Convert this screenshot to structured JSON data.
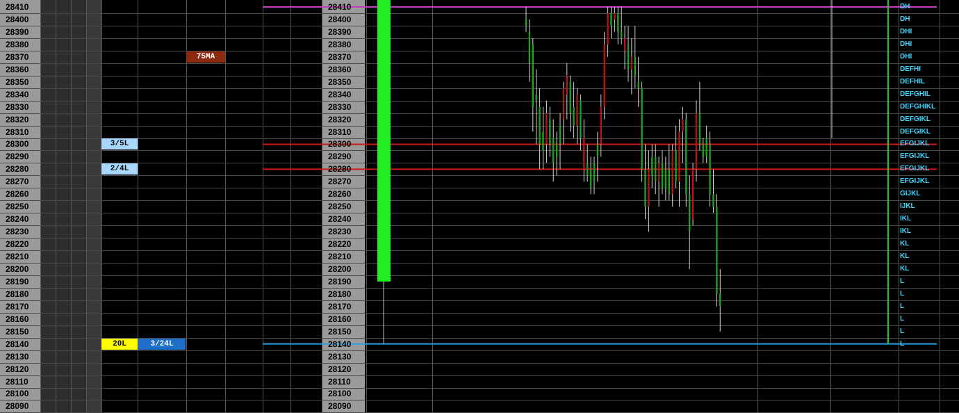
{
  "chart_data": {
    "type": "candlestick",
    "price_axis": {
      "ticks": [
        28410,
        28400,
        28390,
        28380,
        28370,
        28360,
        28350,
        28340,
        28330,
        28320,
        28310,
        28300,
        28290,
        28280,
        28270,
        28260,
        28250,
        28240,
        28230,
        28220,
        28210,
        28200,
        28190,
        28180,
        28170,
        28160,
        28150,
        28140,
        28130,
        28120,
        28110,
        28100,
        28090
      ],
      "ylim": [
        28090,
        28410
      ]
    },
    "level_tags": [
      {
        "label": "75MA",
        "price": 28370,
        "color": "#8a2a10",
        "text_color": "#ffffff"
      },
      {
        "label": "3/5L",
        "price": 28300,
        "color": "#a8d8ff",
        "text_color": "#000000"
      },
      {
        "label": "2/4L",
        "price": 28280,
        "color": "#a8d8ff",
        "text_color": "#000000"
      },
      {
        "label": "20L",
        "price": 28140,
        "color": "#ffff00",
        "text_color": "#000000"
      },
      {
        "label": "3/24L",
        "price": 28140,
        "color": "#1f6fc8",
        "text_color": "#ffffff"
      }
    ],
    "horizontal_lines": [
      {
        "price": 28410,
        "color": "#c040c0"
      },
      {
        "price": 28300,
        "color": "#cc1a1a"
      },
      {
        "price": 28280,
        "color": "#cc1a1a"
      },
      {
        "price": 28140,
        "color": "#2aa0e0"
      }
    ],
    "volume_bar": {
      "top": 28410,
      "bottom": 28190,
      "wick_low": 28140,
      "color": "#22ee22"
    },
    "candles": [
      {
        "o": 28395,
        "h": 28410,
        "l": 28390,
        "c": 28400,
        "color": "green"
      },
      {
        "o": 28390,
        "h": 28400,
        "l": 28350,
        "c": 28365,
        "color": "green"
      },
      {
        "o": 28380,
        "h": 28385,
        "l": 28310,
        "c": 28330,
        "color": "green"
      },
      {
        "o": 28340,
        "h": 28360,
        "l": 28300,
        "c": 28335,
        "color": "green"
      },
      {
        "o": 28330,
        "h": 28345,
        "l": 28280,
        "c": 28300,
        "color": "green"
      },
      {
        "o": 28310,
        "h": 28330,
        "l": 28280,
        "c": 28295,
        "color": "green"
      },
      {
        "o": 28300,
        "h": 28335,
        "l": 28285,
        "c": 28325,
        "color": "red"
      },
      {
        "o": 28320,
        "h": 28330,
        "l": 28290,
        "c": 28300,
        "color": "green"
      },
      {
        "o": 28305,
        "h": 28320,
        "l": 28270,
        "c": 28285,
        "color": "green"
      },
      {
        "o": 28290,
        "h": 28310,
        "l": 28275,
        "c": 28300,
        "color": "green"
      },
      {
        "o": 28300,
        "h": 28325,
        "l": 28280,
        "c": 28315,
        "color": "green"
      },
      {
        "o": 28320,
        "h": 28350,
        "l": 28300,
        "c": 28345,
        "color": "red"
      },
      {
        "o": 28340,
        "h": 28365,
        "l": 28320,
        "c": 28355,
        "color": "red"
      },
      {
        "o": 28350,
        "h": 28355,
        "l": 28310,
        "c": 28325,
        "color": "green"
      },
      {
        "o": 28330,
        "h": 28350,
        "l": 28305,
        "c": 28315,
        "color": "green"
      },
      {
        "o": 28315,
        "h": 28345,
        "l": 28300,
        "c": 28340,
        "color": "red"
      },
      {
        "o": 28335,
        "h": 28340,
        "l": 28295,
        "c": 28305,
        "color": "green"
      },
      {
        "o": 28305,
        "h": 28320,
        "l": 28270,
        "c": 28280,
        "color": "red"
      },
      {
        "o": 28285,
        "h": 28300,
        "l": 28270,
        "c": 28275,
        "color": "green"
      },
      {
        "o": 28280,
        "h": 28290,
        "l": 28260,
        "c": 28265,
        "color": "green"
      },
      {
        "o": 28270,
        "h": 28290,
        "l": 28260,
        "c": 28285,
        "color": "green"
      },
      {
        "o": 28290,
        "h": 28310,
        "l": 28270,
        "c": 28300,
        "color": "green"
      },
      {
        "o": 28300,
        "h": 28340,
        "l": 28290,
        "c": 28330,
        "color": "red"
      },
      {
        "o": 28330,
        "h": 28390,
        "l": 28320,
        "c": 28380,
        "color": "red"
      },
      {
        "o": 28380,
        "h": 28410,
        "l": 28370,
        "c": 28405,
        "color": "red"
      },
      {
        "o": 28405,
        "h": 28410,
        "l": 28385,
        "c": 28395,
        "color": "green"
      },
      {
        "o": 28400,
        "h": 28410,
        "l": 28390,
        "c": 28405,
        "color": "red"
      },
      {
        "o": 28405,
        "h": 28410,
        "l": 28380,
        "c": 28390,
        "color": "green"
      },
      {
        "o": 28390,
        "h": 28410,
        "l": 28380,
        "c": 28385,
        "color": "green"
      },
      {
        "o": 28385,
        "h": 28395,
        "l": 28360,
        "c": 28375,
        "color": "red"
      },
      {
        "o": 28380,
        "h": 28395,
        "l": 28350,
        "c": 28360,
        "color": "green"
      },
      {
        "o": 28360,
        "h": 28385,
        "l": 28340,
        "c": 28370,
        "color": "red"
      },
      {
        "o": 28370,
        "h": 28395,
        "l": 28345,
        "c": 28355,
        "color": "green"
      },
      {
        "o": 28350,
        "h": 28370,
        "l": 28330,
        "c": 28345,
        "color": "green"
      },
      {
        "o": 28345,
        "h": 28350,
        "l": 28270,
        "c": 28280,
        "color": "green"
      },
      {
        "o": 28280,
        "h": 28300,
        "l": 28240,
        "c": 28250,
        "color": "green"
      },
      {
        "o": 28250,
        "h": 28295,
        "l": 28230,
        "c": 28280,
        "color": "red"
      },
      {
        "o": 28275,
        "h": 28300,
        "l": 28265,
        "c": 28290,
        "color": "green"
      },
      {
        "o": 28290,
        "h": 28300,
        "l": 28260,
        "c": 28270,
        "color": "green"
      },
      {
        "o": 28270,
        "h": 28290,
        "l": 28250,
        "c": 28285,
        "color": "red"
      },
      {
        "o": 28285,
        "h": 28295,
        "l": 28260,
        "c": 28265,
        "color": "green"
      },
      {
        "o": 28265,
        "h": 28290,
        "l": 28255,
        "c": 28280,
        "color": "green"
      },
      {
        "o": 28280,
        "h": 28300,
        "l": 28255,
        "c": 28260,
        "color": "green"
      },
      {
        "o": 28260,
        "h": 28300,
        "l": 28250,
        "c": 28295,
        "color": "red"
      },
      {
        "o": 28295,
        "h": 28315,
        "l": 28265,
        "c": 28270,
        "color": "green"
      },
      {
        "o": 28270,
        "h": 28320,
        "l": 28250,
        "c": 28310,
        "color": "red"
      },
      {
        "o": 28310,
        "h": 28330,
        "l": 28285,
        "c": 28320,
        "color": "red"
      },
      {
        "o": 28320,
        "h": 28325,
        "l": 28250,
        "c": 28260,
        "color": "green"
      },
      {
        "o": 28260,
        "h": 28275,
        "l": 28200,
        "c": 28230,
        "color": "green"
      },
      {
        "o": 28240,
        "h": 28285,
        "l": 28235,
        "c": 28280,
        "color": "red"
      },
      {
        "o": 28280,
        "h": 28335,
        "l": 28270,
        "c": 28325,
        "color": "red"
      },
      {
        "o": 28325,
        "h": 28350,
        "l": 28295,
        "c": 28300,
        "color": "green"
      },
      {
        "o": 28300,
        "h": 28305,
        "l": 28285,
        "c": 28290,
        "color": "green"
      },
      {
        "o": 28290,
        "h": 28315,
        "l": 28285,
        "c": 28305,
        "color": "green"
      },
      {
        "o": 28300,
        "h": 28310,
        "l": 28250,
        "c": 28260,
        "color": "green"
      },
      {
        "o": 28260,
        "h": 28280,
        "l": 28245,
        "c": 28250,
        "color": "green"
      },
      {
        "o": 28250,
        "h": 28260,
        "l": 28170,
        "c": 28180,
        "color": "green"
      },
      {
        "o": 28180,
        "h": 28200,
        "l": 28150,
        "c": 28170,
        "color": "green"
      }
    ],
    "profile": {
      "rows": [
        {
          "price": 28410,
          "letters": "DH"
        },
        {
          "price": 28400,
          "letters": "DH"
        },
        {
          "price": 28390,
          "letters": "DHI"
        },
        {
          "price": 28380,
          "letters": "DHI"
        },
        {
          "price": 28370,
          "letters": "DHI"
        },
        {
          "price": 28360,
          "letters": "DEFHI"
        },
        {
          "price": 28350,
          "letters": "DEFHIL"
        },
        {
          "price": 28340,
          "letters": "DEFGHIL"
        },
        {
          "price": 28330,
          "letters": "DEFGHIKL"
        },
        {
          "price": 28320,
          "letters": "DEFGIKL"
        },
        {
          "price": 28310,
          "letters": "DEFGIKL"
        },
        {
          "price": 28300,
          "letters": "EFGIJKL"
        },
        {
          "price": 28290,
          "letters": "EFGIJKL"
        },
        {
          "price": 28280,
          "letters": "EFGIJKL"
        },
        {
          "price": 28270,
          "letters": "EFGIJKL"
        },
        {
          "price": 28260,
          "letters": "GIJKL"
        },
        {
          "price": 28250,
          "letters": "IJKL"
        },
        {
          "price": 28240,
          "letters": "IKL"
        },
        {
          "price": 28230,
          "letters": "IKL"
        },
        {
          "price": 28220,
          "letters": "KL"
        },
        {
          "price": 28210,
          "letters": "KL"
        },
        {
          "price": 28200,
          "letters": "KL"
        },
        {
          "price": 28190,
          "letters": "L"
        },
        {
          "price": 28180,
          "letters": "L"
        },
        {
          "price": 28170,
          "letters": "L"
        },
        {
          "price": 28160,
          "letters": "L"
        },
        {
          "price": 28150,
          "letters": "L"
        },
        {
          "price": 28140,
          "letters": "L"
        }
      ]
    }
  }
}
